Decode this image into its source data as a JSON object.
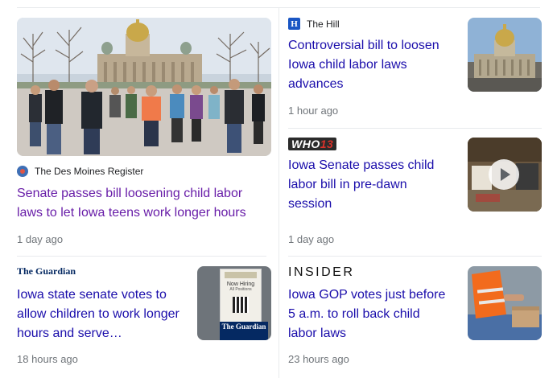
{
  "card1": {
    "source": "The Des Moines Register",
    "title": "Senate passes bill loosening child labor laws to let Iowa teens work longer hours",
    "time": "1 day ago",
    "image_icon": "capitol-protest-image"
  },
  "card2": {
    "source": "The Hill",
    "source_logo": "H",
    "title": "Controversial bill to loosen Iowa child labor laws advances",
    "time": "1 hour ago",
    "image_icon": "capitol-building-image"
  },
  "card3": {
    "source_logo": "WHO13",
    "title": "Iowa Senate passes child labor bill in pre-dawn session",
    "time": "1 day ago",
    "image_icon": "senate-chamber-video-thumbnail"
  },
  "card4": {
    "source_logo": "The Guardian",
    "title": "Iowa state senate votes to allow children to work longer hours and serve…",
    "time": "18 hours ago",
    "image_text_top": "Now Hiring",
    "image_text_sub": "All Positions",
    "image_brand": "The Guardian",
    "image_icon": "now-hiring-sign-image"
  },
  "card5": {
    "source_logo": "INSIDER",
    "title": "Iowa GOP votes just before 5 a.m. to roll back child labor laws",
    "time": "23 hours ago",
    "image_icon": "worker-safety-vest-image"
  },
  "colors": {
    "link": "#1a0dab",
    "visited_link": "#681da8",
    "meta": "#70757a",
    "divider": "#e8eaed"
  }
}
